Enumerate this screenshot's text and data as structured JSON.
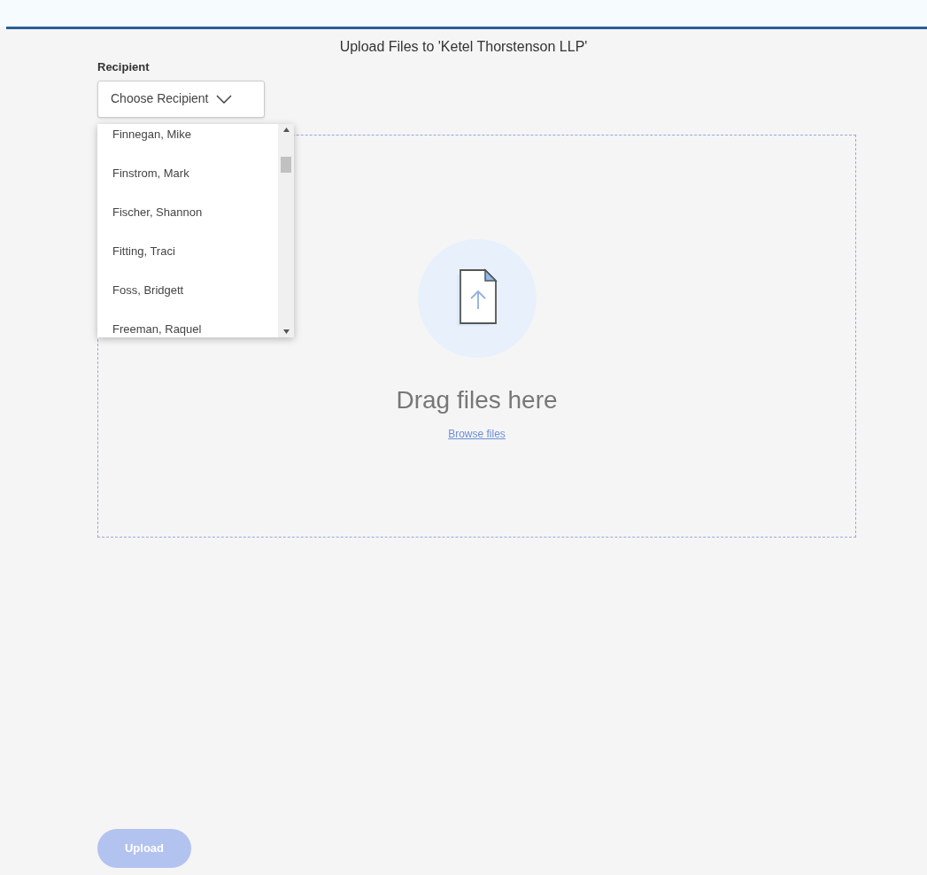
{
  "title": "Upload Files to 'Ketel Thorstenson LLP'",
  "recipient": {
    "label": "Recipient",
    "placeholder": "Choose Recipient",
    "expanded": true,
    "options": [
      {
        "label": "Finnegan, Mike",
        "selected": false
      },
      {
        "label": "Finstrom, Mark",
        "selected": false
      },
      {
        "label": "Fischer, Shannon",
        "selected": false
      },
      {
        "label": "Fitting, Traci",
        "selected": false
      },
      {
        "label": "Foss, Bridgett",
        "selected": false
      },
      {
        "label": "Freeman, Raquel",
        "selected": false
      }
    ]
  },
  "dropzone": {
    "heading": "Drag files here",
    "link": "Browse files"
  },
  "upload_button": {
    "label": "Upload",
    "disabled": true
  }
}
